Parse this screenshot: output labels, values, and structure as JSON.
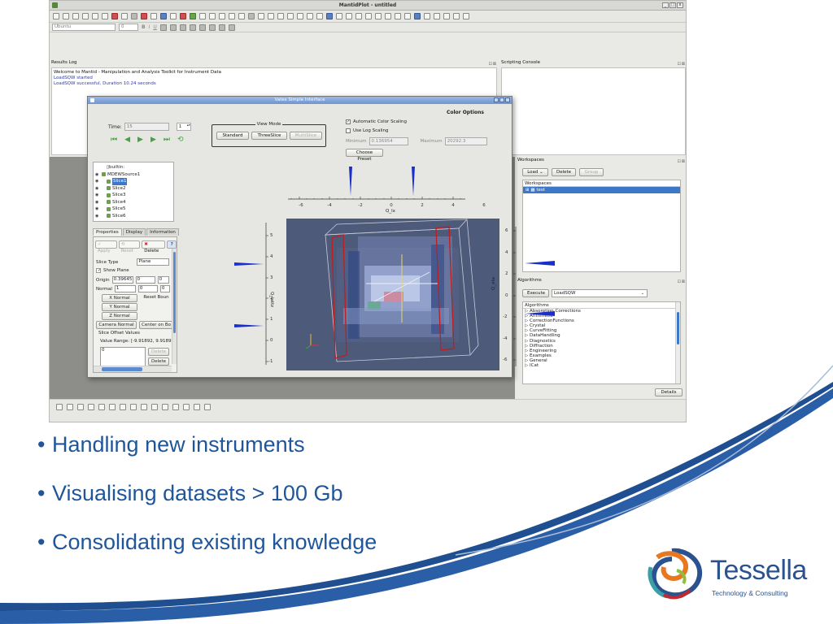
{
  "app": {
    "title": "MantidPlot - untitled",
    "window_buttons": [
      "_",
      "□",
      "x"
    ],
    "toolbar2": {
      "style_combo": "Ubuntu",
      "size_value": "0",
      "format_letters": [
        "B",
        "I",
        "U"
      ]
    }
  },
  "results_log": {
    "title": "Results Log",
    "lines": [
      "Welcome to Mantid - Manipulation and Analysis Toolkit for Instrument Data",
      "LoadSQW started",
      "LoadSQW successful, Duration 10.24 seconds"
    ]
  },
  "scripting_console": {
    "title": "Scripting Console"
  },
  "workspaces": {
    "title": "Workspaces",
    "buttons": {
      "load": "Load",
      "delete": "Delete",
      "group": "Group"
    },
    "list_header": "Workspaces",
    "selected_item": "test"
  },
  "algorithms": {
    "title": "Algorithms",
    "execute_label": "Execute",
    "selected_algorithm": "LoadSQW",
    "tree_header": "Algorithms",
    "items": [
      "Absorption Corrections",
      "Arithmetic",
      "CorrectionFunctions",
      "Crystal",
      "CurveFitting",
      "DataHandling",
      "Diagnostics",
      "Diffraction",
      "Engineering",
      "Examples",
      "General",
      "ICat"
    ],
    "details_label": "Details"
  },
  "vates": {
    "title": "Vates Simple Interface",
    "time_label": "Time:",
    "time_value": "15",
    "time_spin": "1",
    "view_mode": {
      "label": "View Mode",
      "standard": "Standard",
      "threeslice": "ThreeSlice",
      "multislice": "MultiSlice"
    },
    "color_options": {
      "header": "Color Options",
      "auto_scaling": "Automatic Color Scaling",
      "log_scaling": "Use Log Scaling",
      "minimum_label": "Minimum",
      "minimum_value": "0.136954",
      "maximum_label": "Maximum",
      "maximum_value": "20292.3",
      "choose_preset": "Choose Preset"
    },
    "pipeline": {
      "root": "builtin:",
      "source": "MDEWSource1",
      "slices": [
        "Slice1",
        "Slice2",
        "Slice3",
        "Slice4",
        "Slice5",
        "Slice6"
      ]
    },
    "tabs": [
      "Properties",
      "Display",
      "Information"
    ],
    "properties": {
      "apply": "Apply",
      "reset": "Reset",
      "delete": "Delete",
      "help": "?",
      "slice_type_label": "Slice Type",
      "slice_type_value": "Plane",
      "show_plane": "Show Plane",
      "origin_label": "Origin",
      "origin_values": [
        "0.39645",
        "0",
        "0"
      ],
      "normal_label": "Normal",
      "normal_values": [
        "1",
        "0",
        "0"
      ],
      "x_normal": "X Normal",
      "reset_bounds": "Reset Boun",
      "y_normal": "Y Normal",
      "z_normal": "Z Normal",
      "camera_normal": "Camera Normal",
      "center_on_bounds": "Center on Bo",
      "slice_offset_title": "Slice Offset Values",
      "value_range": "Value Range: [-9.91892, 9.91892",
      "offset_value": "0",
      "delete_btn": "Delete",
      "delete_all": "Delete"
    },
    "top_axis": {
      "label": "Q_lx",
      "ticks": [
        "-6",
        "-4",
        "-2",
        "0",
        "2",
        "4",
        "6"
      ]
    },
    "left_axis": {
      "label": "Q_lattz",
      "ticks": [
        "5",
        "4",
        "3",
        "2",
        "1",
        "0",
        "-1"
      ]
    },
    "right_axis": {
      "label": "Q_eta",
      "ticks": [
        "6",
        "4",
        "2",
        "0",
        "-2",
        "-4",
        "-6"
      ]
    }
  },
  "bullets": [
    "Handling new instruments",
    "Visualising datasets > 100 Gb",
    "Consolidating existing knowledge"
  ],
  "logo": {
    "brand": "Tessella",
    "tagline": "Technology & Consulting"
  },
  "colors": {
    "bullet_text": "#1f5699",
    "marker_blue": "#1a2fc9",
    "selection": "#3d77c8",
    "brand": "#2a5290"
  }
}
